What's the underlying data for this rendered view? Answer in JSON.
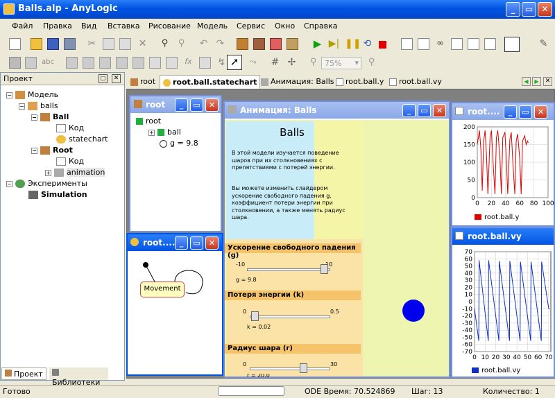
{
  "window": {
    "title": "Balls.alp - AnyLogic"
  },
  "menu": [
    "Файл",
    "Правка",
    "Вид",
    "Вставка",
    "Рисование",
    "Модель",
    "Сервис",
    "Окно",
    "Справка"
  ],
  "zoom": "75%",
  "project": {
    "header": "Проект",
    "tree": [
      {
        "label": "Модель",
        "bold": false
      },
      {
        "label": "balls",
        "bold": false
      },
      {
        "label": "Ball",
        "bold": true
      },
      {
        "label": "Код",
        "bold": false
      },
      {
        "label": "statechart",
        "bold": false
      },
      {
        "label": "Root",
        "bold": true
      },
      {
        "label": "Код",
        "bold": false
      },
      {
        "label": "animation",
        "bold": false
      },
      {
        "label": "Эксперименты",
        "bold": false
      },
      {
        "label": "Simulation",
        "bold": true
      }
    ],
    "bottom_tabs": [
      "Проект",
      "Библиотеки"
    ]
  },
  "tabs": [
    "root",
    "root.ball.statechart",
    "Анимация: Balls",
    "root.ball.y",
    "root.ball.vy"
  ],
  "root_win": {
    "title": "root",
    "items": [
      "root",
      "ball",
      "g = 9.8"
    ]
  },
  "statechart_win": {
    "title": "root....",
    "state": "Movement"
  },
  "anim_win": {
    "title": "Анимация: Balls",
    "heading": "Balls",
    "desc": "В этой модели  изучается поведение шаров при их столкновениях с препятствиями с потерей энергии.",
    "desc2": "Вы можете изменить слайдером ускорение свободного падения g, коэффициент потери энергии при столкновении, а также менять радиус шара.",
    "s1_title": "Ускорение свободного падения  (g)",
    "s1_min": "-10",
    "s1_max": "10",
    "s1_val": "g = 9.8",
    "s2_title": "Потеря энергии (k)",
    "s2_min": "0",
    "s2_max": "0.5",
    "s2_val": "k = 0.02",
    "s3_title": "Радиус шара (r)",
    "s3_min": "0",
    "s3_max": "30",
    "s3_val": "r = 20.0"
  },
  "plot_y": {
    "title": "root....",
    "legend": "root.ball.y",
    "yticks": [
      "200",
      "150",
      "100",
      "50",
      "0"
    ],
    "xticks": [
      "0",
      "20",
      "40",
      "60",
      "80",
      "100"
    ]
  },
  "plot_vy": {
    "title": "root.ball.vy",
    "legend": "root.ball.vy",
    "yticks": [
      "70",
      "60",
      "50",
      "40",
      "30",
      "20",
      "10",
      "0",
      "-10",
      "-20",
      "-30",
      "-40",
      "-50",
      "-60",
      "-70"
    ],
    "xticks": [
      "0",
      "10",
      "20",
      "30",
      "40",
      "50",
      "60",
      "70"
    ]
  },
  "status": {
    "ready": "Готово",
    "time": "ODE Время: 70.524869",
    "step": "Шаг: 13",
    "count": "Количество: 1"
  },
  "colors": {
    "titlebar": "#0054e3",
    "series_y": "#e00000",
    "series_vy": "#1030c0",
    "ball": "#0000ee"
  },
  "chart_data": [
    {
      "type": "line",
      "title": "",
      "series": [
        {
          "name": "root.ball.y",
          "x": [
            0,
            3,
            5,
            7,
            9,
            11,
            13,
            15,
            18,
            20,
            22,
            25,
            27,
            29,
            32,
            34,
            36,
            39,
            41,
            43,
            46,
            48,
            50,
            53,
            55,
            57,
            60,
            62,
            64,
            67,
            69,
            71,
            72
          ],
          "y": [
            150,
            190,
            140,
            20,
            160,
            190,
            120,
            10,
            170,
            190,
            110,
            10,
            170,
            190,
            110,
            10,
            170,
            185,
            110,
            10,
            165,
            185,
            110,
            10,
            160,
            180,
            110,
            10,
            160,
            175,
            150,
            160,
            155
          ]
        }
      ],
      "xlim": [
        0,
        100
      ],
      "ylim": [
        0,
        200
      ]
    },
    {
      "type": "line",
      "title": "",
      "series": [
        {
          "name": "root.ball.vy",
          "x": [
            0,
            4,
            4.3,
            13,
            13.3,
            23,
            23.3,
            33,
            33.3,
            43,
            43.3,
            53,
            53.3,
            63,
            63.3,
            70,
            71
          ],
          "y": [
            -10,
            -55,
            58,
            -55,
            58,
            -55,
            57,
            -55,
            57,
            -55,
            56,
            -55,
            56,
            -55,
            56,
            -10,
            -10
          ]
        }
      ],
      "xlim": [
        0,
        72
      ],
      "ylim": [
        -70,
        70
      ]
    }
  ]
}
